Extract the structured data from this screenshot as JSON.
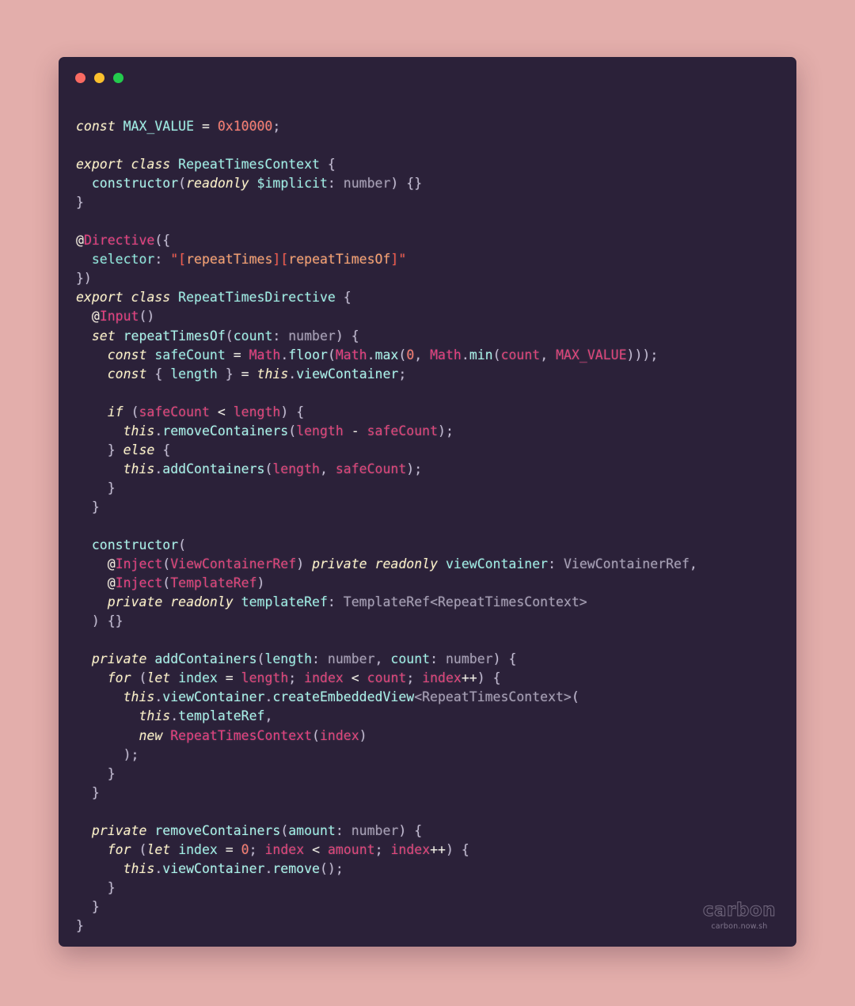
{
  "app": {
    "name": "carbon",
    "watermark_logo": "carbon",
    "watermark_url": "carbon.now.sh",
    "background_color": "#e3aeab",
    "window_color": "#2b2139"
  },
  "titlebar": {
    "close_label": "close",
    "minimize_label": "minimize",
    "maximize_label": "maximize",
    "close_color": "#f96a62",
    "minimize_color": "#fbc02d",
    "maximize_color": "#23cb4d"
  },
  "editor": {
    "language": "typescript",
    "font_size": "16.5px",
    "line_count": 49,
    "code_plain": "const MAX_VALUE = 0x10000;\n\nexport class RepeatTimesContext {\n  constructor(readonly $implicit: number) {}\n}\n\n@Directive({\n  selector: \"[repeatTimes][repeatTimesOf]\"\n})\nexport class RepeatTimesDirective {\n  @Input()\n  set repeatTimesOf(count: number) {\n    const safeCount = Math.floor(Math.max(0, Math.min(count, MAX_VALUE)));\n    const { length } = this.viewContainer;\n\n    if (safeCount < length) {\n      this.removeContainers(length - safeCount);\n    } else {\n      this.addContainers(length, safeCount);\n    }\n  }\n\n  constructor(\n    @Inject(ViewContainerRef) private readonly viewContainer: ViewContainerRef,\n    @Inject(TemplateRef)\n    private readonly templateRef: TemplateRef<RepeatTimesContext>\n  ) {}\n\n  private addContainers(length: number, count: number) {\n    for (let index = length; index < count; index++) {\n      this.viewContainer.createEmbeddedView<RepeatTimesContext>(\n        this.templateRef,\n        new RepeatTimesContext(index)\n      );\n    }\n  }\n\n  private removeContainers(amount: number) {\n    for (let index = 0; index < amount; index++) {\n      this.viewContainer.remove();\n    }\n  }\n}",
    "lines": [
      "const MAX_VALUE = 0x10000;",
      "",
      "export class RepeatTimesContext {",
      "  constructor(readonly $implicit: number) {}",
      "}",
      "",
      "@Directive({",
      "  selector: \"[repeatTimes][repeatTimesOf]\"",
      "})",
      "export class RepeatTimesDirective {",
      "  @Input()",
      "  set repeatTimesOf(count: number) {",
      "    const safeCount = Math.floor(Math.max(0, Math.min(count, MAX_VALUE)));",
      "    const { length } = this.viewContainer;",
      "",
      "    if (safeCount < length) {",
      "      this.removeContainers(length - safeCount);",
      "    } else {",
      "      this.addContainers(length, safeCount);",
      "    }",
      "  }",
      "",
      "  constructor(",
      "    @Inject(ViewContainerRef) private readonly viewContainer: ViewContainerRef,",
      "    @Inject(TemplateRef)",
      "    private readonly templateRef: TemplateRef<RepeatTimesContext>",
      "  ) {}",
      "",
      "  private addContainers(length: number, count: number) {",
      "    for (let index = length; index < count; index++) {",
      "      this.viewContainer.createEmbeddedView<RepeatTimesContext>(",
      "        this.templateRef,",
      "        new RepeatTimesContext(index)",
      "      );",
      "    }",
      "  }",
      "",
      "  private removeContainers(amount: number) {",
      "    for (let index = 0; index < amount; index++) {",
      "      this.viewContainer.remove();",
      "    }",
      "  }",
      "}"
    ],
    "theme_colors": {
      "keyword": "#fdf2c9",
      "class_name": "#9fefe6",
      "function": "#a9f3ea",
      "number": "#f97e72",
      "string": "#f8a171",
      "string_bracket": "#f2594b",
      "variable": "#e0457b",
      "decorator": "#e5407f",
      "type": "#a9a2b8",
      "punctuation": "#c4bdd4",
      "foreground": "#f2f0e6"
    }
  }
}
